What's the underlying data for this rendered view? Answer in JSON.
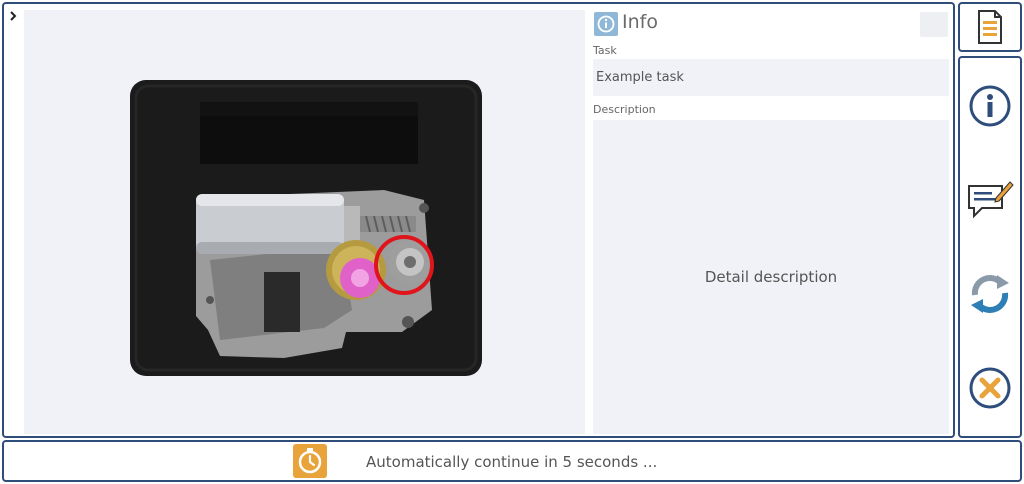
{
  "expand_icon": "chevron-right-icon",
  "info": {
    "title": "Info",
    "task_label": "Task",
    "task_value": "Example task",
    "description_label": "Description",
    "description_value": "Detail description"
  },
  "sidebar": {
    "top_icon": "document-icon",
    "buttons": [
      {
        "icon": "info-icon"
      },
      {
        "icon": "comment-edit-icon"
      },
      {
        "icon": "refresh-icon"
      },
      {
        "icon": "close-icon"
      }
    ]
  },
  "footer": {
    "timer_icon": "stopwatch-icon",
    "countdown_text": "Automatically continue in 5 seconds ..."
  },
  "colors": {
    "frame_border": "#2e4d7b",
    "panel_bg": "#f0f2f7",
    "accent_orange": "#e8a33a",
    "info_blue": "#8fb8d8",
    "highlight_red": "#e0141b"
  }
}
